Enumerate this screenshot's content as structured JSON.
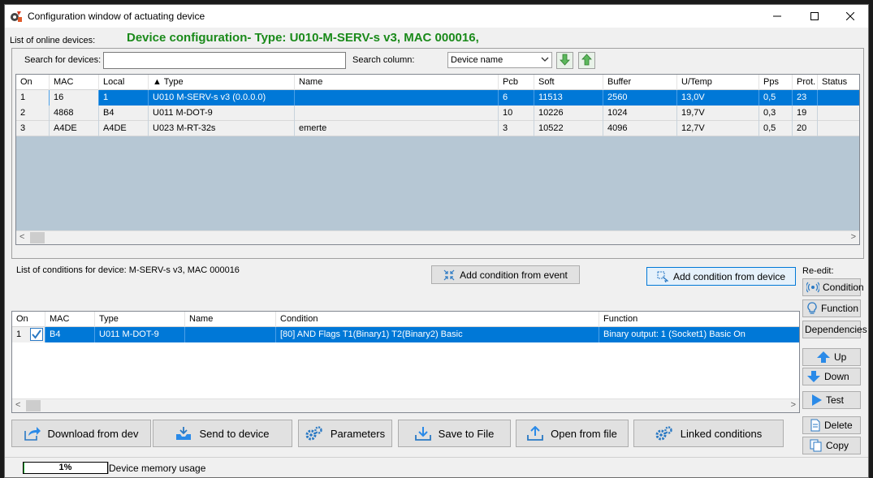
{
  "window": {
    "title": "Configuration window of actuating device"
  },
  "header": {
    "online_label": "List of online devices:",
    "config_title": "Device configuration- Type: U010-M-SERV-s v3, MAC 000016,"
  },
  "search": {
    "label": "Search for devices:",
    "value": "",
    "column_label": "Search column:",
    "column_value": "Device name"
  },
  "devices": {
    "columns": [
      "On",
      "MAC",
      "Local",
      "▲ Type",
      "Name",
      "Pcb",
      "Soft",
      "Buffer",
      "U/Temp",
      "Pps",
      "Prot.",
      "Status"
    ],
    "rows": [
      [
        "1",
        "16",
        "1",
        "U010 M-SERV-s v3 (0.0.0.0)",
        "",
        "6",
        "11513",
        "2560",
        "13,0V",
        "0,5",
        "23",
        ""
      ],
      [
        "2",
        "4868",
        "B4",
        "U011 M-DOT-9",
        "",
        "10",
        "10226",
        "1024",
        "19,7V",
        "0,3",
        "19",
        ""
      ],
      [
        "3",
        "A4DE",
        "A4DE",
        "U023 M-RT-32s",
        "emerte",
        "3",
        "10522",
        "4096",
        "12,7V",
        "0,5",
        "20",
        ""
      ]
    ]
  },
  "conditions": {
    "label": "List of conditions for device: M-SERV-s v3, MAC 000016",
    "add_from_event": "Add condition from event",
    "add_from_device": "Add condition from device",
    "reedit_label": "Re-edit:",
    "columns": [
      "On",
      "MAC",
      "Type",
      "Name",
      "Condition",
      "Function"
    ],
    "rows": [
      [
        "1",
        "B4",
        "U011 M-DOT-9",
        "",
        "[80] AND  Flags T1(Binary1) T2(Binary2)  Basic",
        "Binary output:  1 (Socket1)  Basic On"
      ]
    ]
  },
  "side_buttons": {
    "condition": "Condition",
    "function": "Function",
    "dependencies": "Dependencies",
    "up": "Up",
    "down": "Down",
    "test": "Test",
    "delete": "Delete",
    "copy": "Copy"
  },
  "bottom_buttons": {
    "download": "Download from dev",
    "send": "Send to device",
    "parameters": "Parameters",
    "save": "Save to File",
    "open": "Open from file",
    "linked": "Linked conditions"
  },
  "status": {
    "progress_text": "1%",
    "progress_value": 0.01,
    "memory_label": "Device memory usage"
  },
  "colors": {
    "title_green": "#1a8a1a",
    "selection_blue": "#0078d7",
    "grid_bg": "#b6c7d4"
  }
}
